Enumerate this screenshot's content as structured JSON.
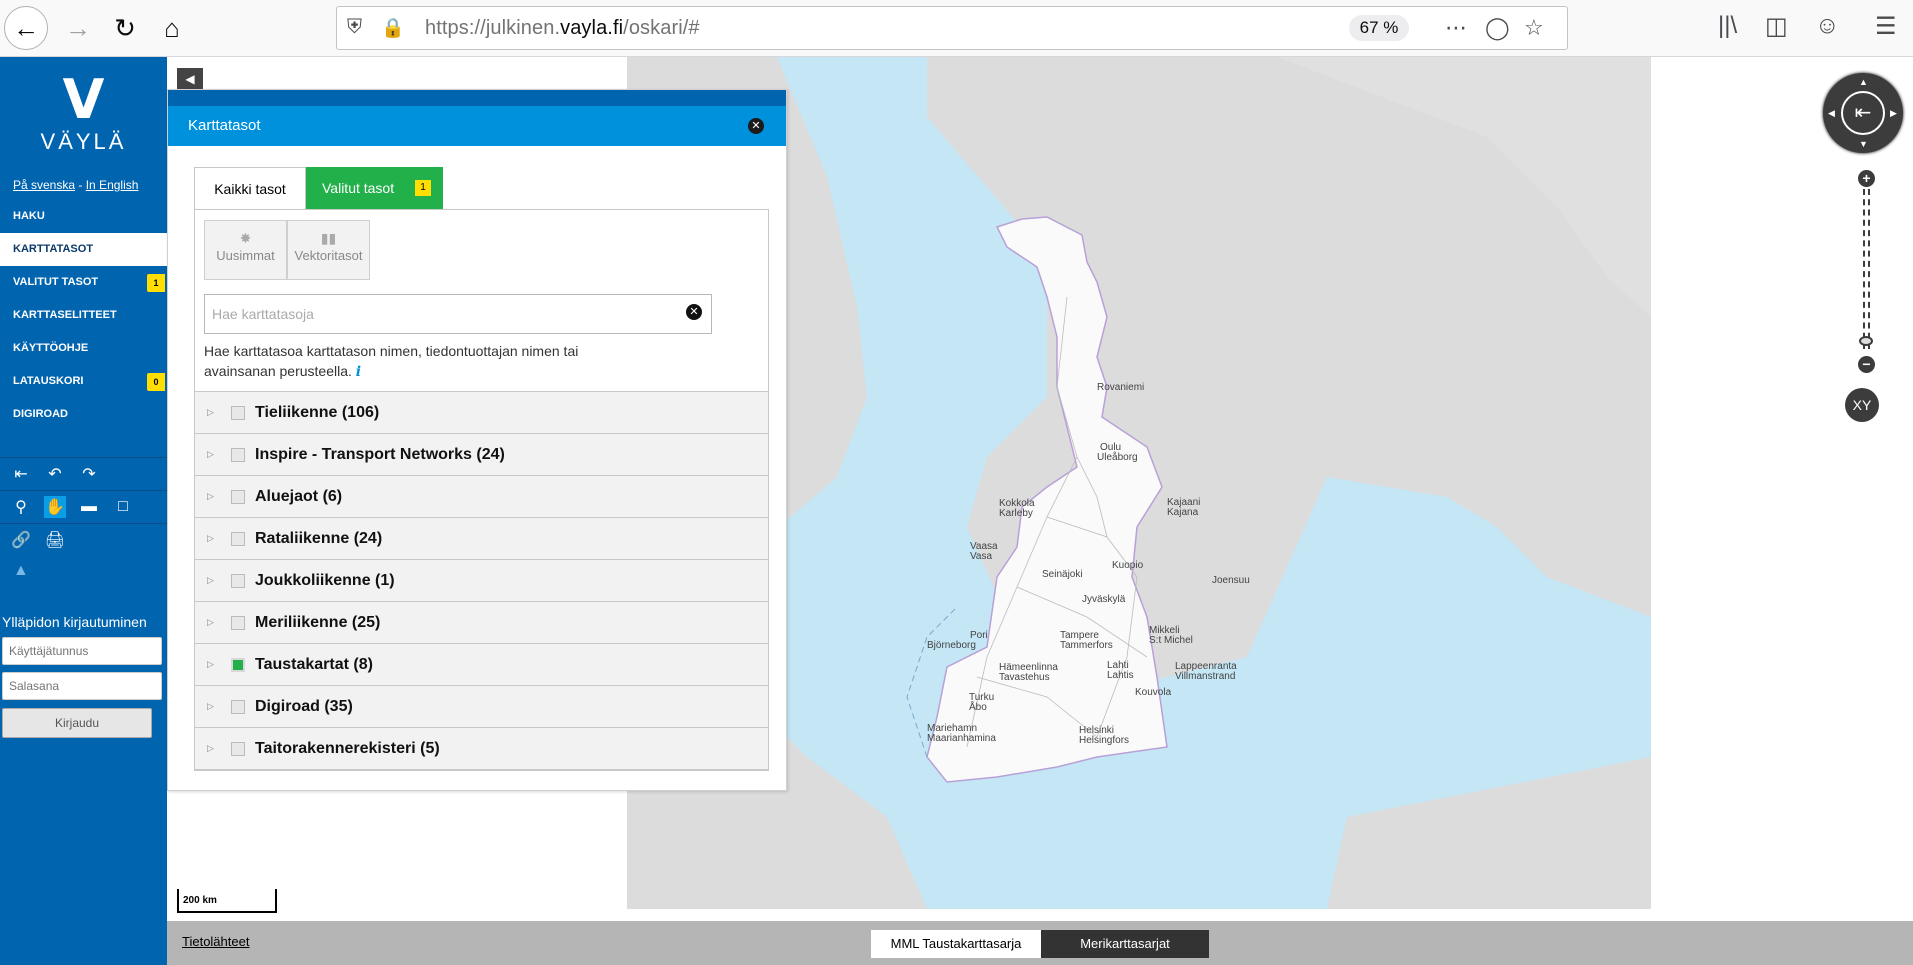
{
  "browser": {
    "url_prefix": "https://julkinen.",
    "url_domain": "vayla.fi",
    "url_path": "/oskari/#",
    "zoom": "67 %"
  },
  "sidebar": {
    "logo_text": "VÄYLÄ",
    "lang_sv": "På svenska",
    "lang_sep": " - ",
    "lang_en": "In English",
    "items": [
      {
        "label": "HAKU"
      },
      {
        "label": "KARTTATASOT"
      },
      {
        "label": "VALITUT TASOT",
        "badge": "1"
      },
      {
        "label": "KARTTASELITTEET"
      },
      {
        "label": "KÄYTTÖOHJE"
      },
      {
        "label": "LATAUSKORI",
        "badge": "0"
      },
      {
        "label": "DIGIROAD"
      }
    ],
    "login_title": "Ylläpidon kirjautuminen",
    "username_placeholder": "Käyttäjätunnus",
    "password_placeholder": "Salasana",
    "login_button": "Kirjaudu"
  },
  "flyout": {
    "title": "Karttatasot",
    "tab_all": "Kaikki tasot",
    "tab_selected": "Valitut tasot",
    "tab_selected_count": "1",
    "filter_newest": "Uusimmat",
    "filter_vector": "Vektoritasot",
    "search_placeholder": "Hae karttatasoja",
    "search_help": "Hae karttatasoa karttatason nimen, tiedontuottajan nimen tai avainsanan perusteella.",
    "groups": [
      {
        "label": "Tieliikenne (106)",
        "checked": false
      },
      {
        "label": "Inspire - Transport Networks (24)",
        "checked": false
      },
      {
        "label": "Aluejaot (6)",
        "checked": false
      },
      {
        "label": "Rataliikenne (24)",
        "checked": false
      },
      {
        "label": "Joukkoliikenne (1)",
        "checked": false
      },
      {
        "label": "Meriliikenne (25)",
        "checked": false
      },
      {
        "label": "Taustakartat (8)",
        "checked": true
      },
      {
        "label": "Digiroad (35)",
        "checked": false
      },
      {
        "label": "Taitorakennerekisteri (5)",
        "checked": false
      }
    ]
  },
  "map": {
    "cities": [
      "Rovaniemi",
      "Oulu",
      "Uleåborg",
      "Kokkola",
      "Karleby",
      "Kajaani",
      "Kajana",
      "Vaasa",
      "Vasa",
      "Seinäjoki",
      "Kuopio",
      "Joensuu",
      "Jyväskylä",
      "Pori",
      "Björneborg",
      "Tampere",
      "Tammerfors",
      "Mikkeli",
      "S:t Michel",
      "Hämeenlinna",
      "Tavastehus",
      "Lahti",
      "Lahtis",
      "Lappeenranta",
      "Villmanstrand",
      "Turku",
      "Åbo",
      "Kouvola",
      "Mariehamn",
      "Maarianhamina",
      "Helsinki",
      "Helsingfors"
    ],
    "scale_label": "200 km",
    "xy_label": "XY",
    "sources_link": "Tietolähteet",
    "bg_mml": "MML Taustakarttasarja",
    "bg_meri": "Merikarttasarjat"
  }
}
